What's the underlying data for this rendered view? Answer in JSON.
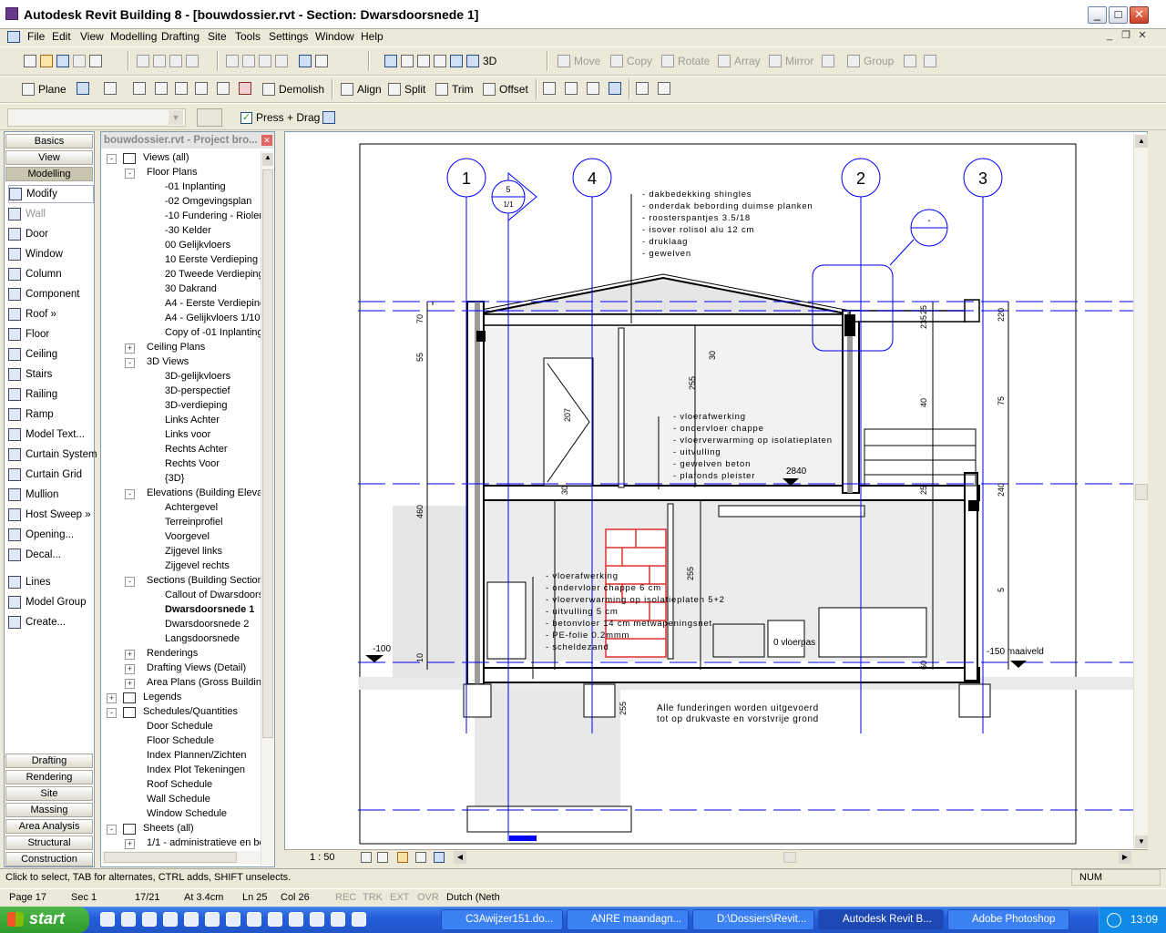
{
  "window": {
    "title": "Autodesk Revit Building 8 - [bouwdossier.rvt - Section: Dwarsdoorsnede 1]"
  },
  "menu": [
    "File",
    "Edit",
    "View",
    "Modelling",
    "Drafting",
    "Site",
    "Tools",
    "Settings",
    "Window",
    "Help"
  ],
  "toolbar1": {
    "view3d": "3D",
    "move": "Move",
    "copy": "Copy",
    "rotate": "Rotate",
    "array": "Array",
    "mirror": "Mirror",
    "group": "Group"
  },
  "toolbar2": {
    "plane": "Plane",
    "demolish": "Demolish",
    "align": "Align",
    "split": "Split",
    "trim": "Trim",
    "offset": "Offset"
  },
  "options": {
    "press_drag": "Press + Drag",
    "press_drag_checked": true
  },
  "design_bar": {
    "tabs_top": [
      "Basics",
      "View",
      "Modelling"
    ],
    "items": [
      "Modify",
      "Wall",
      "Door",
      "Window",
      "Column",
      "Component",
      "Roof »",
      "Floor",
      "Ceiling",
      "Stairs",
      "Railing",
      "Ramp",
      "Model Text...",
      "Curtain System",
      "Curtain Grid",
      "Mullion",
      "Host Sweep »",
      "Opening...",
      "Decal...",
      "Lines",
      "Model Group",
      "Create..."
    ],
    "tabs_bottom": [
      "Drafting",
      "Rendering",
      "Site",
      "Massing",
      "Area Analysis",
      "Structural",
      "Construction"
    ]
  },
  "browser": {
    "title": "bouwdossier.rvt - Project bro...",
    "tree": [
      {
        "label": "Views (all)",
        "level": 0,
        "exp": "-",
        "icon": "eye"
      },
      {
        "label": "Floor Plans",
        "level": 1,
        "exp": "-"
      },
      {
        "label": "-01 Inplanting",
        "level": 2
      },
      {
        "label": "-02 Omgevingsplan",
        "level": 2
      },
      {
        "label": "-10 Fundering - Rioleri",
        "level": 2
      },
      {
        "label": "-30 Kelder",
        "level": 2
      },
      {
        "label": "00 Gelijkvloers",
        "level": 2
      },
      {
        "label": "10 Eerste Verdieping",
        "level": 2
      },
      {
        "label": "20 Tweede Verdieping",
        "level": 2
      },
      {
        "label": "30 Dakrand",
        "level": 2
      },
      {
        "label": "A4 - Eerste Verdieping",
        "level": 2
      },
      {
        "label": "A4 - Gelijkvloers 1/10",
        "level": 2
      },
      {
        "label": "Copy of -01 Inplanting",
        "level": 2
      },
      {
        "label": "Ceiling Plans",
        "level": 1,
        "exp": "+"
      },
      {
        "label": "3D Views",
        "level": 1,
        "exp": "-"
      },
      {
        "label": "3D-gelijkvloers",
        "level": 2
      },
      {
        "label": "3D-perspectief",
        "level": 2
      },
      {
        "label": "3D-verdieping",
        "level": 2
      },
      {
        "label": "Links Achter",
        "level": 2
      },
      {
        "label": "Links voor",
        "level": 2
      },
      {
        "label": "Rechts Achter",
        "level": 2
      },
      {
        "label": "Rechts Voor",
        "level": 2
      },
      {
        "label": "{3D}",
        "level": 2
      },
      {
        "label": "Elevations (Building Eleva",
        "level": 1,
        "exp": "-"
      },
      {
        "label": "Achtergevel",
        "level": 2
      },
      {
        "label": "Terreinprofiel",
        "level": 2
      },
      {
        "label": "Voorgevel",
        "level": 2
      },
      {
        "label": "Zijgevel links",
        "level": 2
      },
      {
        "label": "Zijgevel rechts",
        "level": 2
      },
      {
        "label": "Sections (Building Section",
        "level": 1,
        "exp": "-"
      },
      {
        "label": "Callout of Dwarsdoors",
        "level": 2
      },
      {
        "label": "Dwarsdoorsnede 1",
        "level": 2,
        "bold": true
      },
      {
        "label": "Dwarsdoorsnede 2",
        "level": 2
      },
      {
        "label": "Langsdoorsnede",
        "level": 2
      },
      {
        "label": "Renderings",
        "level": 1,
        "exp": "+"
      },
      {
        "label": "Drafting Views (Detail)",
        "level": 1,
        "exp": "+"
      },
      {
        "label": "Area Plans (Gross Building",
        "level": 1,
        "exp": "+"
      },
      {
        "label": "Legends",
        "level": 0,
        "exp": "+",
        "icon": "grid"
      },
      {
        "label": "Schedules/Quantities",
        "level": 0,
        "exp": "-",
        "icon": "grid"
      },
      {
        "label": "Door Schedule",
        "level": 1
      },
      {
        "label": "Floor Schedule",
        "level": 1
      },
      {
        "label": "Index Plannen/Zichten",
        "level": 1
      },
      {
        "label": "Index Plot Tekeningen",
        "level": 1
      },
      {
        "label": "Roof Schedule",
        "level": 1
      },
      {
        "label": "Wall Schedule",
        "level": 1
      },
      {
        "label": "Window Schedule",
        "level": 1
      },
      {
        "label": "Sheets (all)",
        "level": 0,
        "exp": "-",
        "icon": "sheet"
      },
      {
        "label": "1/1 - administratieve en bo",
        "level": 1,
        "exp": "+"
      }
    ]
  },
  "drawing": {
    "grids": [
      "1",
      "4",
      "2",
      "3"
    ],
    "section_tag": {
      "num": "5",
      "sheet": "1/1"
    },
    "callout": "-",
    "roof_notes": [
      "- dakbedekking shingles",
      "- onderdak bebording duimse planken",
      "- roosterspantjes 3.5/18",
      "- isover rolisol alu 12 cm",
      "- druklaag",
      "- gewelven"
    ],
    "floor1_notes": [
      "- vloerafwerking",
      "- ondervloer chappe",
      "- vloerverwarming op isolatieplaten",
      "- uitvulling",
      "- gewelven beton",
      "- plafonds pleister"
    ],
    "ground_notes": [
      "- vloerafwerking",
      "- ondervloer chappe 6 cm",
      "- vloerverwarming op isolatieplaten 5+2",
      "- uitvulling 5 cm",
      "- betonvloer 14 cm metwapeningsnet",
      "- PE-folie 0.2mmm",
      "- scheldezand"
    ],
    "foundation_note": [
      "Alle funderingen worden uitgevoerd",
      "tot op drukvaste en vorstvrije grond"
    ],
    "level_2840": "2840",
    "level_m100": "-100",
    "level_m150": "-150 maaiveld",
    "floor_label": "0 vloerpas",
    "dims": [
      "70",
      "55",
      "460",
      "10",
      "30",
      "255",
      "207",
      "255",
      "255",
      "30",
      "25",
      "235",
      "40",
      "25",
      "60",
      "220",
      "75",
      "240",
      "5"
    ]
  },
  "viewbar": {
    "scale": "1 : 50"
  },
  "status": {
    "hint": "Click to select, TAB for alternates, CTRL adds, SHIFT unselects.",
    "num": "NUM"
  },
  "status2": {
    "page": "Page 17",
    "sec": "Sec 1",
    "pos": "17/21",
    "at": "At 3.4cm",
    "ln": "Ln 25",
    "col": "Col 26",
    "rec": "REC",
    "trk": "TRK",
    "ext": "EXT",
    "ovr": "OVR",
    "lang": "Dutch (Neth"
  },
  "taskbar": {
    "start": "start",
    "tasks": [
      "C3Awijzer151.do...",
      "ANRE maandagn...",
      "D:\\Dossiers\\Revit...",
      "Autodesk Revit B...",
      "Adobe Photoshop"
    ],
    "clock": "13:09"
  },
  "colors": {
    "grid_line": "#0000ff",
    "brick": "#e03030",
    "titlebar": "#ffffff",
    "taskbar": "#245edb"
  }
}
